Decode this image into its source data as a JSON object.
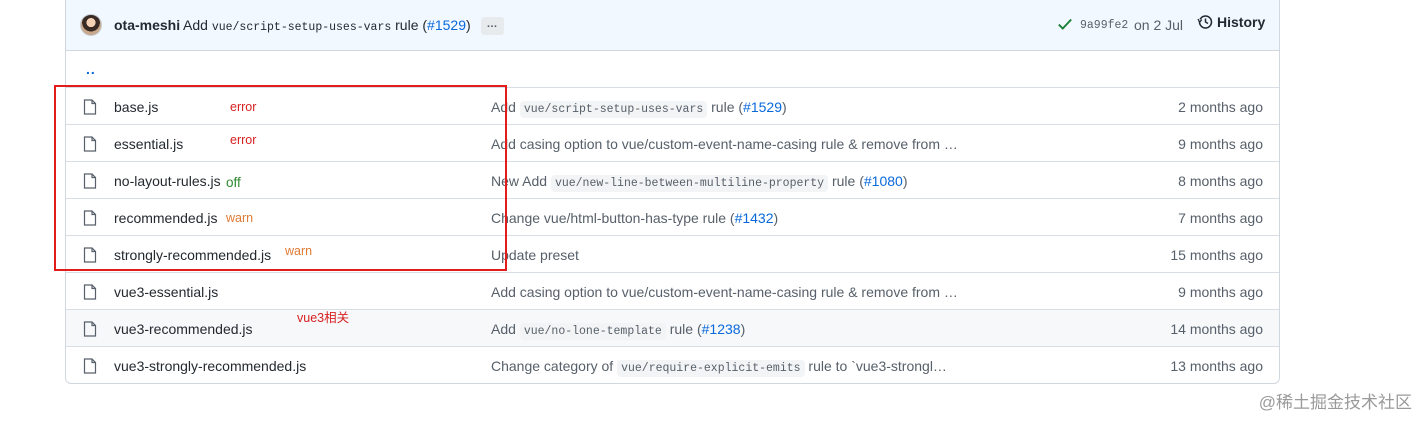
{
  "commit": {
    "author": "ota-meshi",
    "message_prefix": "Add",
    "message_code": "vue/script-setup-uses-vars",
    "message_suffix": "rule (",
    "pr": "#1529",
    "pr_close": ")",
    "more": "…",
    "sha": "9a99fe2",
    "date": "on 2 Jul",
    "history": "History"
  },
  "parent_dir": "..",
  "files": [
    {
      "name": "base.js",
      "msg_pre": "Add",
      "msg_code": "vue/script-setup-uses-vars",
      "msg_post": "rule (",
      "pr": "#1529",
      "pr_close": ")",
      "age": "2 months ago"
    },
    {
      "name": "essential.js",
      "msg_pre": "Add casing option to vue/custom-event-name-casing rule & remove from …",
      "msg_code": "",
      "msg_post": "",
      "pr": "",
      "pr_close": "",
      "age": "9 months ago"
    },
    {
      "name": "no-layout-rules.js",
      "msg_pre": "New Add",
      "msg_code": "vue/new-line-between-multiline-property",
      "msg_post": "rule (",
      "pr": "#1080",
      "pr_close": ")",
      "age": "8 months ago"
    },
    {
      "name": "recommended.js",
      "msg_pre": "Change vue/html-button-has-type rule (",
      "msg_code": "",
      "msg_post": "",
      "pr": "#1432",
      "pr_close": ")",
      "age": "7 months ago"
    },
    {
      "name": "strongly-recommended.js",
      "msg_pre": "Update preset",
      "msg_code": "",
      "msg_post": "",
      "pr": "",
      "pr_close": "",
      "age": "15 months ago"
    },
    {
      "name": "vue3-essential.js",
      "msg_pre": "Add casing option to vue/custom-event-name-casing rule & remove from …",
      "msg_code": "",
      "msg_post": "",
      "pr": "",
      "pr_close": "",
      "age": "9 months ago"
    },
    {
      "name": "vue3-recommended.js",
      "msg_pre": "Add",
      "msg_code": "vue/no-lone-template",
      "msg_post": "rule (",
      "pr": "#1238",
      "pr_close": ")",
      "age": "14 months ago"
    },
    {
      "name": "vue3-strongly-recommended.js",
      "msg_pre": "Change category of",
      "msg_code": "vue/require-explicit-emits",
      "msg_post": "rule to `vue3-strongl…",
      "pr": "",
      "pr_close": "",
      "age": "13 months ago"
    }
  ],
  "annotations": {
    "base": "error",
    "essential": "error",
    "no_layout": "off",
    "recommended": "warn",
    "strongly": "warn",
    "vue3": "vue3相关"
  },
  "watermark": "@稀土掘金技术社区",
  "colors": {
    "link": "#0969da",
    "annotation_box": "#e21b1b",
    "header_bg": "#f1f8ff"
  }
}
